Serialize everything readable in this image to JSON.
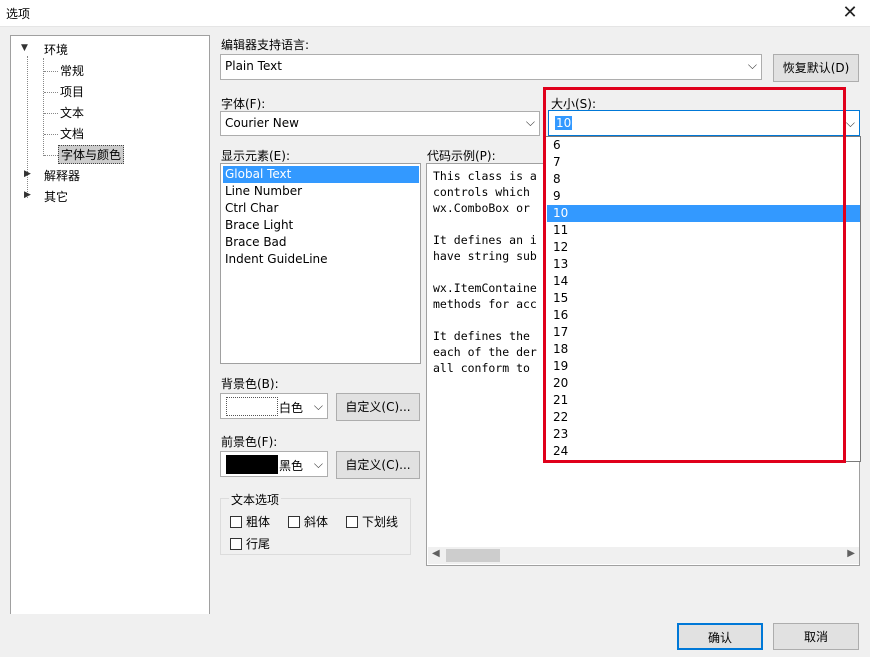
{
  "window": {
    "title": "选项",
    "close_glyph": "✕"
  },
  "tree": {
    "root": "环境",
    "children": [
      "常规",
      "项目",
      "文本",
      "文档",
      "字体与颜色"
    ],
    "others": [
      "解释器",
      "其它"
    ]
  },
  "editor_lang": {
    "label": "编辑器支持语言:",
    "value": "Plain Text",
    "reset_button": "恢复默认(D)"
  },
  "font": {
    "label": "字体(F):",
    "value": "Courier New"
  },
  "size": {
    "label": "大小(S):",
    "value": "10",
    "options": [
      "6",
      "7",
      "8",
      "9",
      "10",
      "11",
      "12",
      "13",
      "14",
      "15",
      "16",
      "17",
      "18",
      "19",
      "20",
      "21",
      "22",
      "23",
      "24"
    ],
    "selected": "10"
  },
  "display_elements": {
    "label": "显示元素(E):",
    "items": [
      "Global Text",
      "Line Number",
      "Ctrl Char",
      "Brace Light",
      "Brace Bad",
      "Indent GuideLine"
    ],
    "selected": "Global Text"
  },
  "code_sample": {
    "label": "代码示例(P):",
    "lines": [
      "This class is a",
      "controls which",
      "wx.ComboBox or",
      "",
      "It defines an i",
      "have string sub",
      "",
      "wx.ItemContaine",
      "methods for acc",
      "",
      "It defines the",
      "each of the der",
      "all conform to"
    ]
  },
  "background": {
    "label": "背景色(B):",
    "value": "白色",
    "custom_button": "自定义(C)...",
    "color": "#ffffff"
  },
  "foreground": {
    "label": "前景色(F):",
    "value": "黑色",
    "custom_button": "自定义(C)...",
    "color": "#000000"
  },
  "text_options": {
    "title": "文本选项",
    "bold": "粗体",
    "italic": "斜体",
    "underline": "下划线",
    "eol": "行尾"
  },
  "footer": {
    "ok": "确认",
    "cancel": "取消"
  },
  "colors": {
    "highlight": "#3399ff",
    "annotation_red": "#e0001b"
  }
}
